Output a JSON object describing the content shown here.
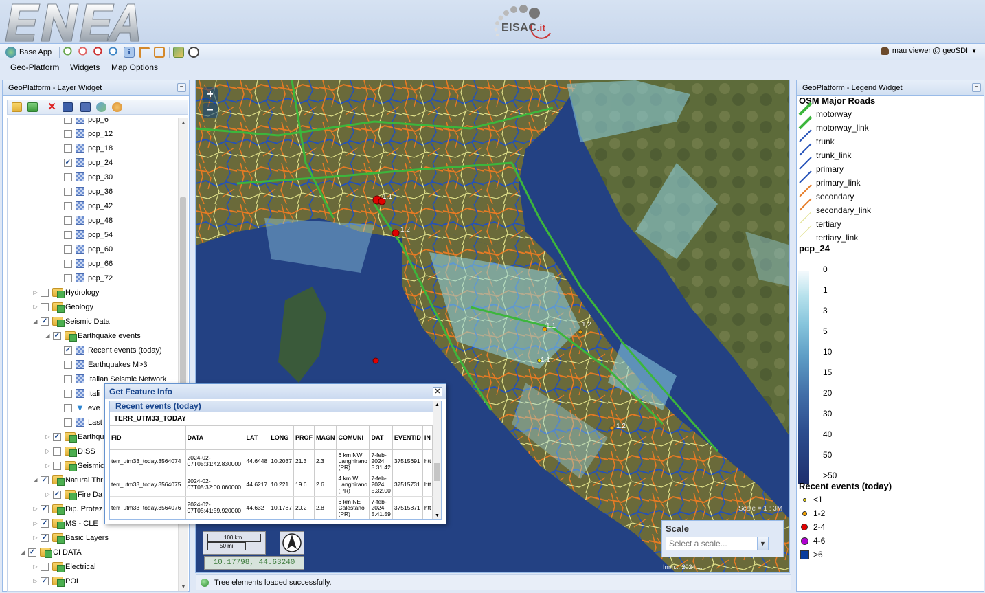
{
  "header": {
    "logo_left": "ENEA",
    "logo_right": "EISAC",
    "logo_right_suffix": ".it"
  },
  "toolbar": {
    "base_app": "Base App",
    "user": "mau viewer @ geoSDI"
  },
  "menu": [
    "Geo-Platform",
    "Widgets",
    "Map Options"
  ],
  "layer_panel": {
    "title": "GeoPlatform - Layer Widget",
    "rows": [
      {
        "label": "pcp_6",
        "indent": 4,
        "type": "layer",
        "checked": false
      },
      {
        "label": "pcp_12",
        "indent": 4,
        "type": "layer",
        "checked": false
      },
      {
        "label": "pcp_18",
        "indent": 4,
        "type": "layer",
        "checked": false
      },
      {
        "label": "pcp_24",
        "indent": 4,
        "type": "layer",
        "checked": true
      },
      {
        "label": "pcp_30",
        "indent": 4,
        "type": "layer",
        "checked": false
      },
      {
        "label": "pcp_36",
        "indent": 4,
        "type": "layer",
        "checked": false
      },
      {
        "label": "pcp_42",
        "indent": 4,
        "type": "layer",
        "checked": false
      },
      {
        "label": "pcp_48",
        "indent": 4,
        "type": "layer",
        "checked": false
      },
      {
        "label": "pcp_54",
        "indent": 4,
        "type": "layer",
        "checked": false
      },
      {
        "label": "pcp_60",
        "indent": 4,
        "type": "layer",
        "checked": false
      },
      {
        "label": "pcp_66",
        "indent": 4,
        "type": "layer",
        "checked": false
      },
      {
        "label": "pcp_72",
        "indent": 4,
        "type": "layer",
        "checked": false
      },
      {
        "label": "Hydrology",
        "indent": 2,
        "type": "folder",
        "checked": false,
        "tri": "▷"
      },
      {
        "label": "Geology",
        "indent": 2,
        "type": "folder",
        "checked": false,
        "tri": "▷"
      },
      {
        "label": "Seismic Data",
        "indent": 2,
        "type": "folder",
        "checked": true,
        "tri": "◢"
      },
      {
        "label": "Earthquake events",
        "indent": 3,
        "type": "folder",
        "checked": true,
        "tri": "◢"
      },
      {
        "label": "Recent events (today)",
        "indent": 4,
        "type": "layer",
        "checked": true
      },
      {
        "label": "Earthquakes M>3",
        "indent": 4,
        "type": "layer",
        "checked": false
      },
      {
        "label": "Italian Seismic Network",
        "indent": 4,
        "type": "layer",
        "checked": false
      },
      {
        "label": "Itali",
        "indent": 4,
        "type": "layer",
        "checked": false
      },
      {
        "label": "eve",
        "indent": 4,
        "type": "filter",
        "checked": false
      },
      {
        "label": "Last",
        "indent": 4,
        "type": "layer",
        "checked": false
      },
      {
        "label": "Earthqu",
        "indent": 3,
        "type": "folder",
        "checked": true,
        "tri": "▷"
      },
      {
        "label": "DISS",
        "indent": 3,
        "type": "folder",
        "checked": false,
        "tri": "▷"
      },
      {
        "label": "Seismic",
        "indent": 3,
        "type": "folder",
        "checked": false,
        "tri": "▷"
      },
      {
        "label": "Natural Thr",
        "indent": 2,
        "type": "folder",
        "checked": true,
        "tri": "◢"
      },
      {
        "label": "Fire Da",
        "indent": 3,
        "type": "folder",
        "checked": true,
        "tri": "▷"
      },
      {
        "label": "Dip. Protez",
        "indent": 2,
        "type": "folder",
        "checked": true,
        "tri": "▷"
      },
      {
        "label": "MS - CLE",
        "indent": 2,
        "type": "folder",
        "checked": true,
        "tri": "▷"
      },
      {
        "label": "Basic Layers",
        "indent": 2,
        "type": "folder",
        "checked": true,
        "tri": "▷"
      },
      {
        "label": "CI DATA",
        "indent": 1,
        "type": "folder",
        "checked": true,
        "tri": "◢"
      },
      {
        "label": "Electrical",
        "indent": 2,
        "type": "folder",
        "checked": false,
        "tri": "▷"
      },
      {
        "label": "POI",
        "indent": 2,
        "type": "folder",
        "checked": true,
        "tri": "▷"
      }
    ]
  },
  "status": {
    "message": "Tree elements loaded successfully."
  },
  "map": {
    "coords": "10.17798, 44.63240",
    "scale_km": "100 km",
    "scale_mi": "50 mi",
    "scale_title": "Scale",
    "scale_placeholder": "Select a scale...",
    "attribution": "Imm... 2024 ...",
    "scale_text": "Scale = 1 : 3M",
    "event_labels": [
      "1.1",
      "1.2",
      "1.1",
      "1.2",
      "1.1",
      "1.2"
    ]
  },
  "gfi": {
    "title": "Get Feature Info",
    "section": "Recent events (today)",
    "layer_name": "TERR_UTM33_TODAY",
    "columns": [
      "FID",
      "DATA",
      "LAT",
      "LONG",
      "PROF",
      "MAGN",
      "COMUNI",
      "DAT",
      "EVENTID",
      "IN"
    ],
    "rows": [
      [
        "terr_utm33_today.3564074",
        "2024-02-07T05:31:42.830000",
        "44.6448",
        "10.2037",
        "21.3",
        "2.3",
        "6 km NW Langhirano (PR)",
        "7-feb-2024 5.31.42",
        "37515691",
        "htt"
      ],
      [
        "terr_utm33_today.3564075",
        "2024-02-07T05:32:00.060000",
        "44.6217",
        "10.221",
        "19.6",
        "2.6",
        "4 km W Langhirano (PR)",
        "7-feb-2024 5.32.00",
        "37515731",
        "htt"
      ],
      [
        "terr_utm33_today.3564076",
        "2024-02-07T05:41:59.920000",
        "44.632",
        "10.1787",
        "20.2",
        "2.8",
        "6 km NE Calestano (PR)",
        "7-feb-2024 5.41.59",
        "37515871",
        "htt"
      ]
    ]
  },
  "legend": {
    "title": "GeoPlatform - Legend Widget",
    "osm_title": "OSM Major Roads",
    "roads": [
      {
        "label": "motorway",
        "color": "#3cb63c",
        "w": 4
      },
      {
        "label": "motorway_link",
        "color": "#3cb63c",
        "w": 4
      },
      {
        "label": "trunk",
        "color": "#2451b8",
        "w": 2
      },
      {
        "label": "trunk_link",
        "color": "#2451b8",
        "w": 2
      },
      {
        "label": "primary",
        "color": "#2451b8",
        "w": 2
      },
      {
        "label": "primary_link",
        "color": "#2451b8",
        "w": 2
      },
      {
        "label": "secondary",
        "color": "#e57a24",
        "w": 1.5
      },
      {
        "label": "secondary_link",
        "color": "#e57a24",
        "w": 1.5
      },
      {
        "label": "tertiary",
        "color": "#e0e08a",
        "w": 1
      },
      {
        "label": "tertiary_link",
        "color": "#e0e08a",
        "w": 1
      }
    ],
    "pcp_title": "pcp_24",
    "ramp": [
      "0",
      "1",
      "3",
      "5",
      "10",
      "15",
      "20",
      "30",
      "40",
      "50",
      ">50"
    ],
    "events_title": "Recent events (today)",
    "events": [
      {
        "label": "<1",
        "color": "#f5e000",
        "size": 5
      },
      {
        "label": "1-2",
        "color": "#f2a000",
        "size": 7
      },
      {
        "label": "2-4",
        "color": "#e00000",
        "size": 10
      },
      {
        "label": "4-6",
        "color": "#b000d0",
        "size": 11
      },
      {
        "label": ">6",
        "color": "#0a3c9c",
        "size": 13,
        "square": true
      }
    ]
  }
}
